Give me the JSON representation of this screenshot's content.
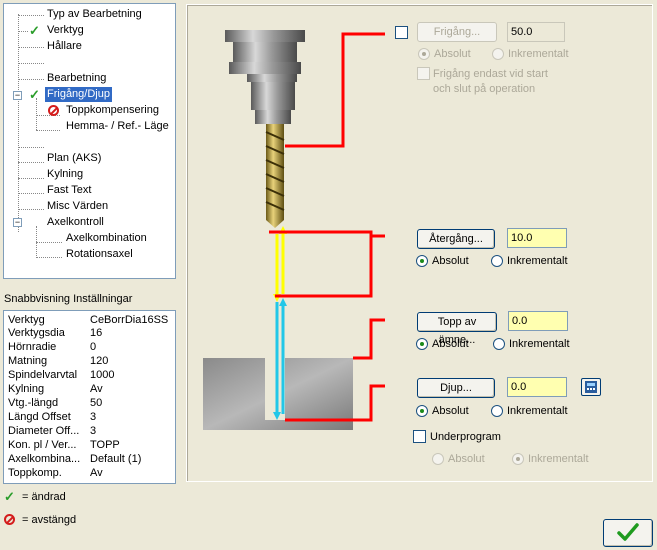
{
  "tree": {
    "items": [
      {
        "label": "Typ av Bearbetning"
      },
      {
        "label": "Verktyg",
        "changed": true
      },
      {
        "label": "Hållare"
      },
      {
        "label": ""
      },
      {
        "label": "Bearbetning"
      },
      {
        "label": "Frigång/Djup",
        "changed": true,
        "selected": true,
        "expander": "−"
      },
      {
        "label": "Toppkompensering",
        "disabled_marker": true
      },
      {
        "label": "Hemma- / Ref.- Läge"
      },
      {
        "label": ""
      },
      {
        "label": "Plan (AKS)"
      },
      {
        "label": "Kylning"
      },
      {
        "label": "Fast Text"
      },
      {
        "label": "Misc Värden"
      },
      {
        "label": "Axelkontroll",
        "expander": "−"
      },
      {
        "label": "Axelkombination"
      },
      {
        "label": "Rotationsaxel"
      }
    ]
  },
  "quickview": {
    "title": "Snabbvisning Inställningar",
    "rows": [
      {
        "key": "Verktyg",
        "value": "CeBorrDia16SS"
      },
      {
        "key": "Verktygsdia",
        "value": "16"
      },
      {
        "key": "Hörnradie",
        "value": "0"
      },
      {
        "key": "Matning",
        "value": "120"
      },
      {
        "key": "Spindelvarvtal",
        "value": "1000"
      },
      {
        "key": "Kylning",
        "value": "Av"
      },
      {
        "key": "Vtg.-längd",
        "value": "50"
      },
      {
        "key": "Längd Offset",
        "value": "3"
      },
      {
        "key": "Diameter Off...",
        "value": "3"
      },
      {
        "key": "Kon. pl / Ver...",
        "value": "TOPP"
      },
      {
        "key": "Axelkombina...",
        "value": "Default (1)"
      },
      {
        "key": "Toppkomp.",
        "value": "Av"
      }
    ]
  },
  "legend": {
    "changed": "= ändrad",
    "disabled": "= avstängd"
  },
  "clearance": {
    "button": "Frigång...",
    "value": "50.0",
    "absolute": "Absolut",
    "incremental": "Inkrementalt",
    "only_start_end_line1": "Frigång endast vid start",
    "only_start_end_line2": "och slut på operation"
  },
  "retract": {
    "button": "Återgång...",
    "value": "10.0",
    "absolute": "Absolut",
    "incremental": "Inkrementalt"
  },
  "top_stock": {
    "button": "Topp av ämne...",
    "value": "0.0",
    "absolute": "Absolut",
    "incremental": "Inkrementalt"
  },
  "depth": {
    "button": "Djup...",
    "value": "0.0",
    "absolute": "Absolut",
    "incremental": "Inkrementalt"
  },
  "subprogram": {
    "label": "Underprogram",
    "absolute": "Absolut",
    "incremental": "Inkrementalt"
  },
  "colors": {
    "leader": "#ff0000",
    "retract_arrow": "#ffff00",
    "feed_arrow": "#22c7e8",
    "input_bg": "#ffffb0",
    "selection": "#316ac5",
    "check": "#2a9d2a"
  }
}
